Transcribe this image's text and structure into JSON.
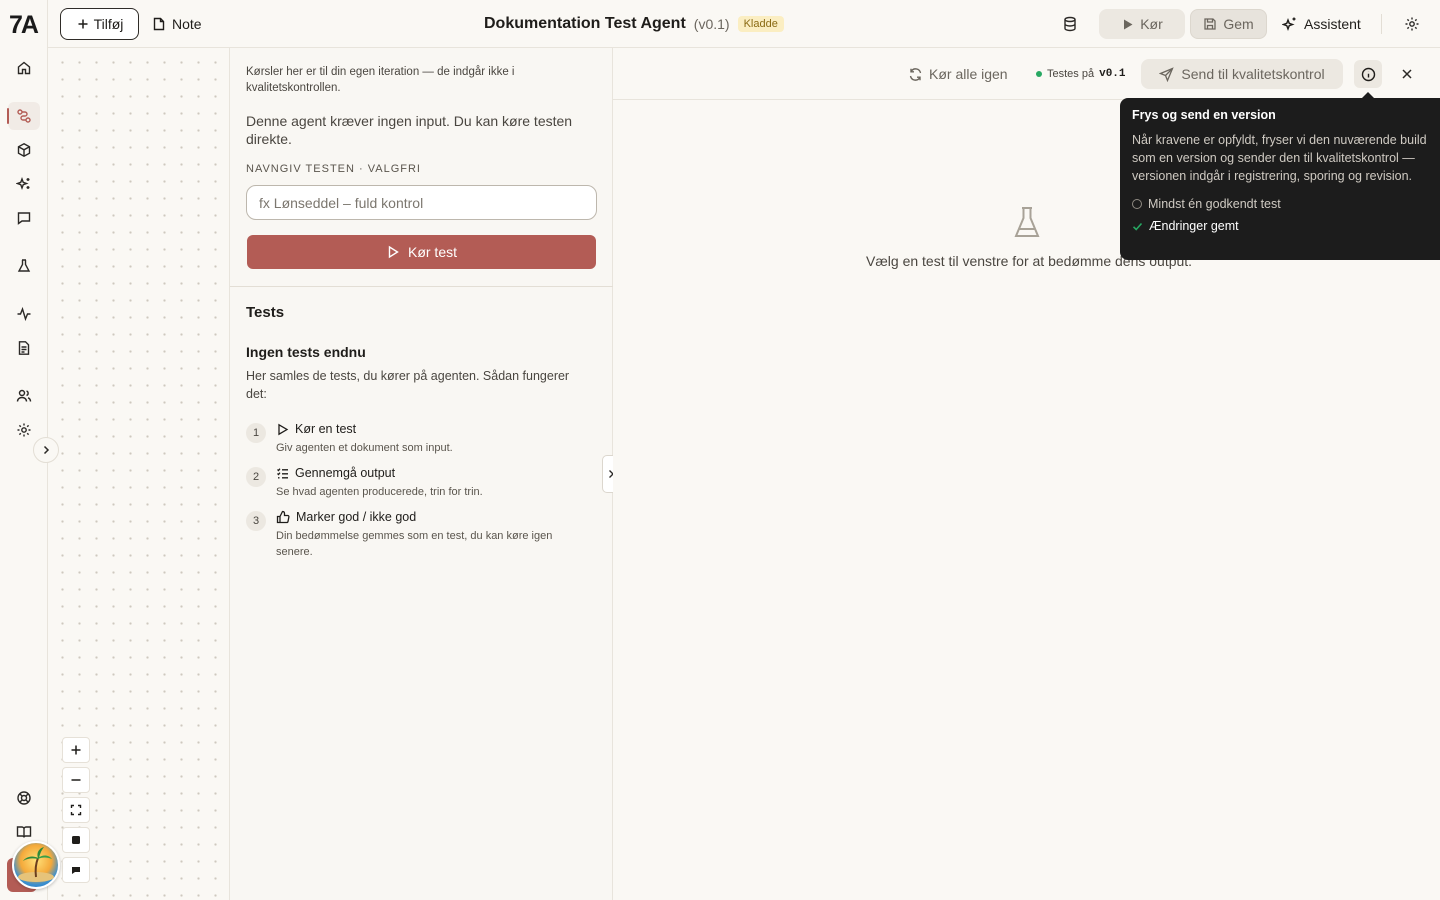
{
  "app": {
    "logo_text": "7A"
  },
  "rail": {
    "items": [
      {
        "id": "home",
        "icon": "home-icon"
      },
      {
        "id": "workflows",
        "icon": "workflow-icon",
        "active": true
      },
      {
        "id": "packages",
        "icon": "box-icon"
      },
      {
        "id": "skills",
        "icon": "sparkle-icon"
      },
      {
        "id": "chat",
        "icon": "chat-icon"
      },
      {
        "id": "tests",
        "icon": "flask-icon"
      },
      {
        "id": "activity",
        "icon": "activity-icon"
      },
      {
        "id": "documents",
        "icon": "document-icon"
      },
      {
        "id": "users",
        "icon": "users-icon"
      },
      {
        "id": "settings",
        "icon": "gear-icon"
      },
      {
        "id": "help",
        "icon": "lifebuoy-icon"
      },
      {
        "id": "docs",
        "icon": "book-icon"
      }
    ]
  },
  "topbar": {
    "add_label": "Tilføj",
    "note_label": "Note",
    "title": "Dokumentation Test Agent",
    "version": "(v0.1)",
    "status_badge": "Kladde",
    "run_label": "Kør",
    "save_label": "Gem",
    "assistant_label": "Assistent"
  },
  "panel": {
    "note": "Kørsler her er til din egen iteration — de indgår ikke i kvalitetskontrollen.",
    "no_input": "Denne agent kræver ingen input. Du kan køre testen direkte.",
    "name_label": "NAVNGIV TESTEN · VALGFRI",
    "name_placeholder": "fx Lønseddel – fuld kontrol",
    "run_test_label": "Kør test",
    "tests_heading": "Tests",
    "empty_title": "Ingen tests endnu",
    "empty_desc": "Her samles de tests, du kører på agenten. Sådan fungerer det:",
    "steps": [
      {
        "num": "1",
        "title": "Kør en test",
        "desc": "Giv agenten et dokument som input."
      },
      {
        "num": "2",
        "title": "Gennemgå output",
        "desc": "Se hvad agenten producerede, trin for trin."
      },
      {
        "num": "3",
        "title": "Marker god / ikke god",
        "desc": "Din bedømmelse gemmes som en test, du kan køre igen senere."
      }
    ]
  },
  "main": {
    "rerun_label": "Kør alle igen",
    "testing_on_label": "Testes på",
    "testing_version": "v0.1",
    "send_label": "Send til kvalitetskontrol",
    "empty_text": "Vælg en test til venstre for at bedømme dens output."
  },
  "tooltip": {
    "title": "Frys og send en version",
    "body": "Når kravene er opfyldt, fryser vi den nuværende build som en version og sender den til kvalitetskontrol — versionen indgår i registrering, sporing og revision.",
    "requirements": [
      {
        "label": "Mindst én godkendt test",
        "met": false
      },
      {
        "label": "Ændringer gemt",
        "met": true
      }
    ]
  },
  "colors": {
    "accent": "#b35c55",
    "status_ok": "#27a862",
    "badge_bg": "#fbeec2"
  }
}
